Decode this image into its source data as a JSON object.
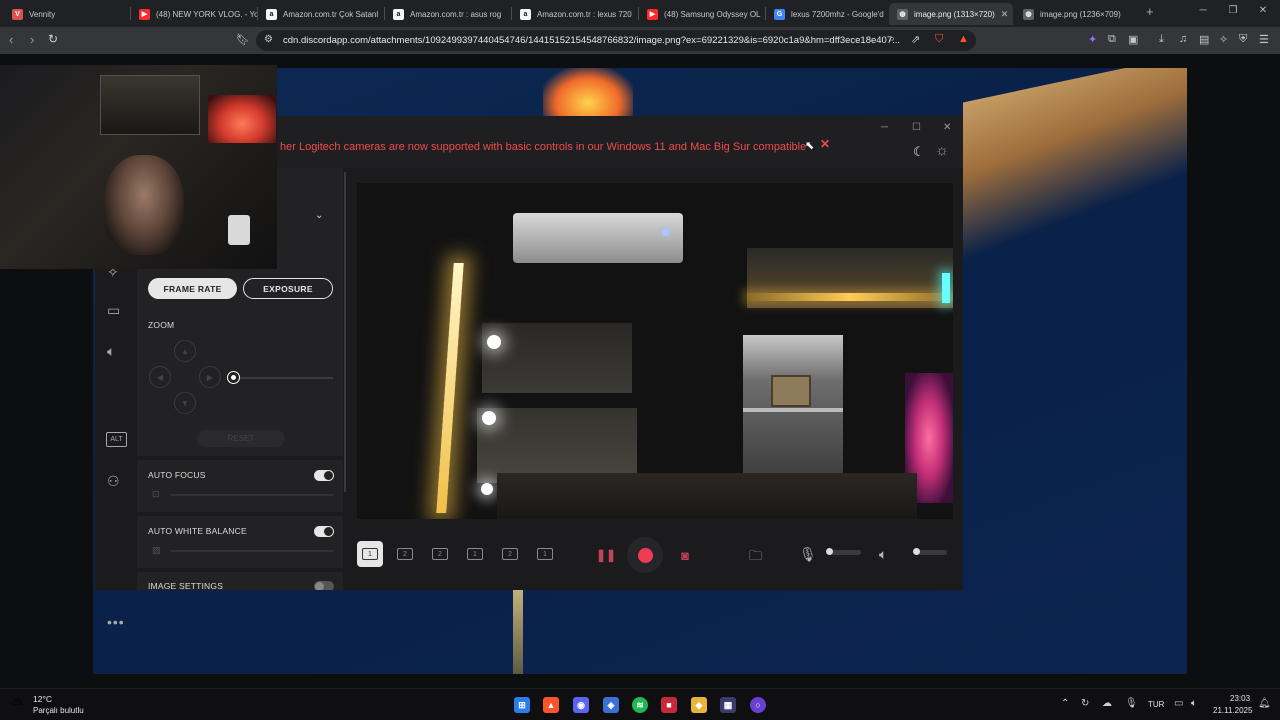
{
  "browser": {
    "tabs": [
      {
        "title": "Vennity",
        "favicon_color": "#d9534f",
        "favicon": "V"
      },
      {
        "title": "(48) NEW YORK VLOG. - Yo",
        "favicon_color": "#ff2a2a",
        "favicon": "▶"
      },
      {
        "title": "Amazon.com.tr Çok Satanl",
        "favicon_color": "#f5f5f5",
        "favicon": "a"
      },
      {
        "title": "Amazon.com.tr : asus rog",
        "favicon_color": "#f5f5f5",
        "favicon": "a"
      },
      {
        "title": "Amazon.com.tr : lexus 720",
        "favicon_color": "#f5f5f5",
        "favicon": "a"
      },
      {
        "title": "(48) Samsung Odyssey OL",
        "favicon_color": "#ff2a2a",
        "favicon": "▶"
      },
      {
        "title": "lexus 7200mhz - Google'd",
        "favicon_color": "#4285f4",
        "favicon": "G"
      },
      {
        "title": "image.png (1313×720)",
        "favicon_color": "#9aa0a6",
        "favicon": "◍",
        "active": true
      },
      {
        "title": "image.png (1236×709)",
        "favicon_color": "#9aa0a6",
        "favicon": "◍"
      }
    ],
    "url": "cdn.discordapp.com/attachments/1092499397440454746/1441515215454876683​2/image.png?ex=69221329&is=6920c1a9&hm=dff3ece18e407..."
  },
  "app": {
    "banner": "her Logitech cameras are now supported with basic controls in our Windows 11 and Mac Big Sur compatible",
    "tabs": {
      "frame_rate": "FRAME RATE",
      "exposure": "EXPOSURE"
    },
    "zoom_label": "ZOOM",
    "zoom_level": 0,
    "reset_label": "RESET",
    "auto_focus_label": "AUTO FOCUS",
    "auto_focus_on": true,
    "awb_label": "AUTO WHITE BALANCE",
    "awb_on": true,
    "image_settings_label": "IMAGE SETTINGS",
    "image_settings_on": false,
    "alt_label": "ALT",
    "layouts": [
      "1",
      "2",
      "2",
      "1",
      "2",
      "1"
    ]
  },
  "taskbar": {
    "temperature": "12°C",
    "weather": "Parçalı bulutlu",
    "language": "TUR",
    "time": "23:03",
    "date": "21.11.2025"
  }
}
